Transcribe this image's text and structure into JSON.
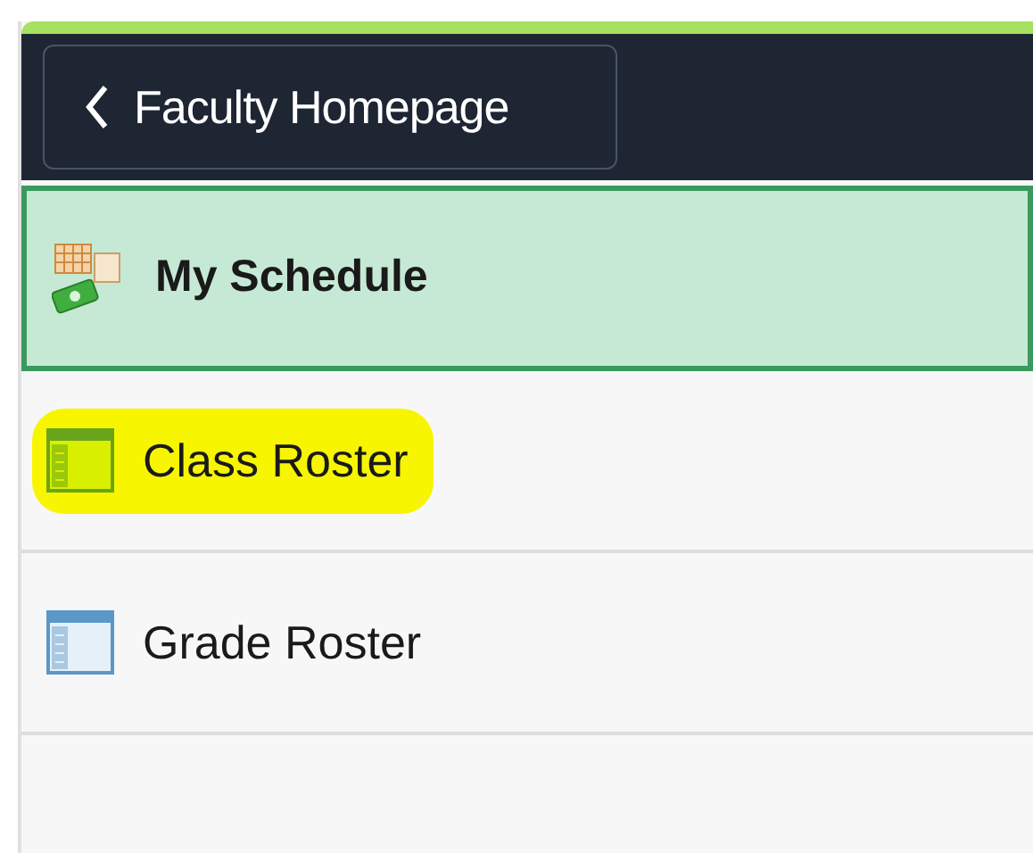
{
  "back_button": {
    "label": "Faculty Homepage"
  },
  "items": [
    {
      "label": "My Schedule",
      "kind": "schedule",
      "selected": true,
      "highlighted": false
    },
    {
      "label": "Class Roster",
      "kind": "roster",
      "selected": false,
      "highlighted": true
    },
    {
      "label": "Grade Roster",
      "kind": "roster",
      "selected": false,
      "highlighted": false
    }
  ]
}
